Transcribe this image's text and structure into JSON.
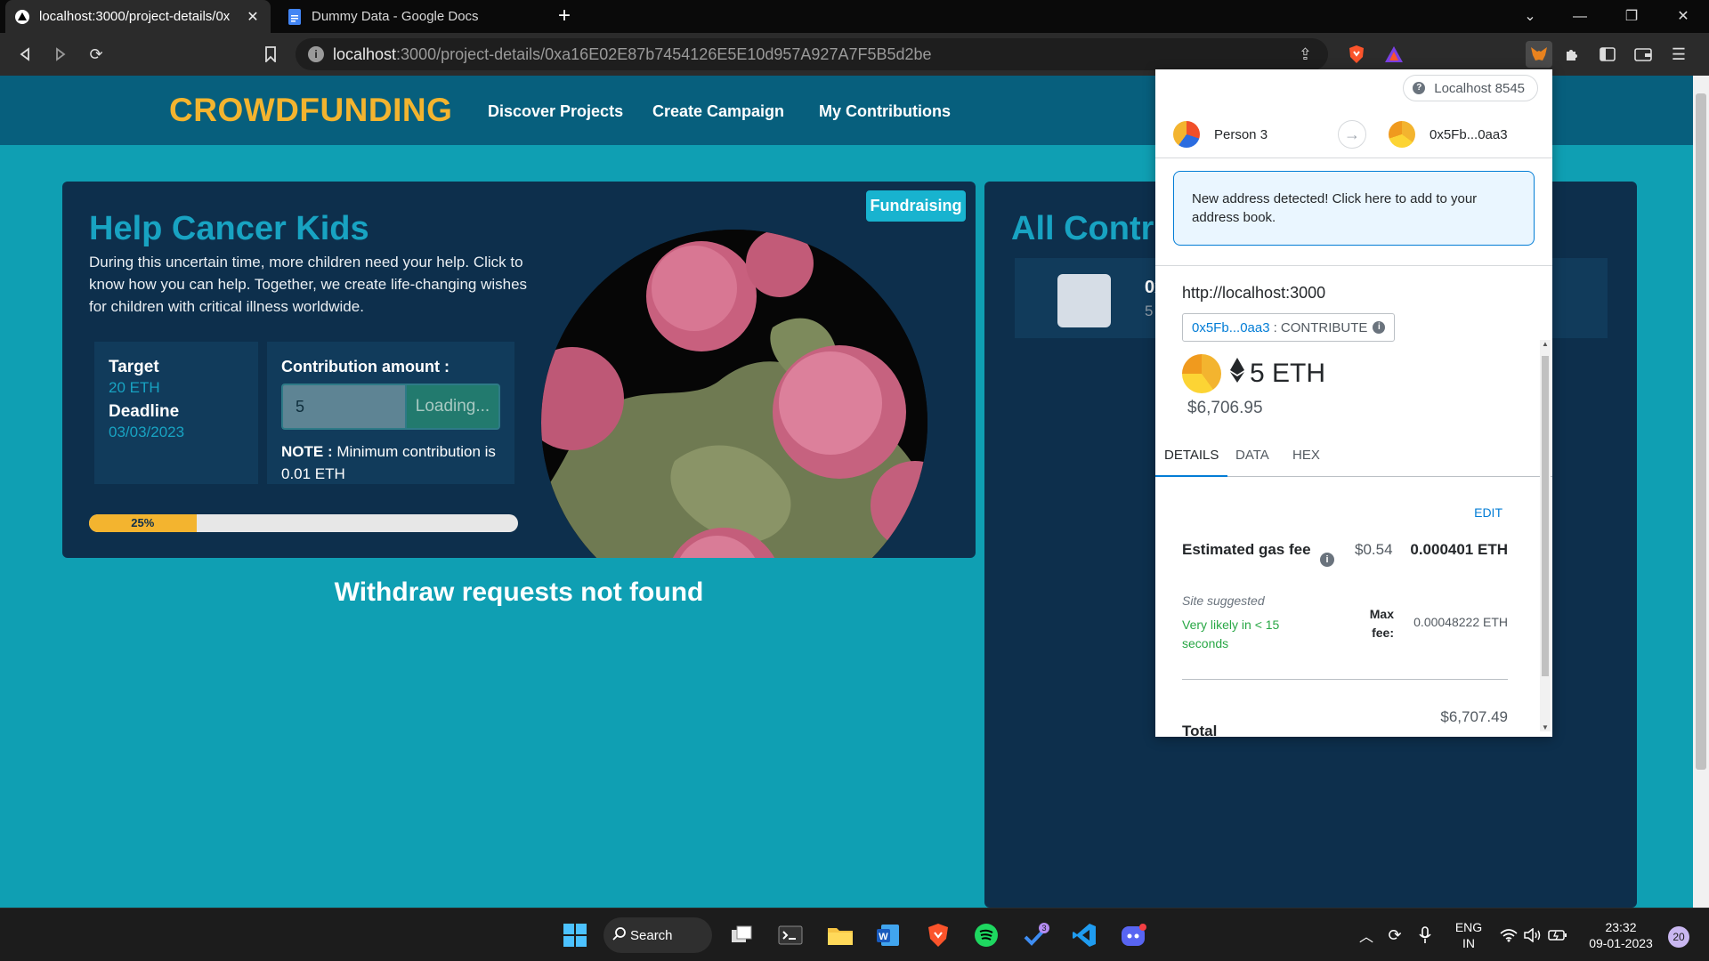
{
  "browser": {
    "tabs": [
      {
        "title": "localhost:3000/project-details/0x"
      },
      {
        "title": "Dummy Data - Google Docs"
      }
    ],
    "url_host": "localhost",
    "url_rest": ":3000/project-details/0xa16E02E87b7454126E5E10d957A927A7F5B5d2be"
  },
  "navbar": {
    "brand": "CROWDFUNDING",
    "links": [
      "Discover Projects",
      "Create Campaign",
      "My Contributions"
    ]
  },
  "project": {
    "status": "Fundraising",
    "title": "Help Cancer Kids",
    "description": "During this uncertain time, more children need your help. Click to know how you can help. Together, we create life-changing wishes for children with critical illness worldwide.",
    "target_label": "Target",
    "target_value": "20 ETH",
    "deadline_label": "Deadline",
    "deadline_value": "03/03/2023",
    "contribution_label": "Contribution amount :",
    "contribution_value": "5",
    "contribute_button": "Loading...",
    "note_label": "NOTE :",
    "note_text": "Minimum contribution is 0.01 ETH",
    "progress": 0.25,
    "progress_label": "25%"
  },
  "withdraw_message": "Withdraw requests not found",
  "contributions": {
    "title": "All Contri",
    "items": [
      {
        "address": "0x",
        "amount": "5"
      }
    ]
  },
  "metamask": {
    "network": "Localhost 8545",
    "from_account": "Person 3",
    "to_account": "0x5Fb...0aa3",
    "alert": "New address detected! Click here to add to your address book.",
    "origin": "http://localhost:3000",
    "method_address": "0x5Fb...0aa3",
    "method_name": ": CONTRIBUTE",
    "amount": "5 ETH",
    "amount_fiat": "$6,706.95",
    "tabs": [
      "DETAILS",
      "DATA",
      "HEX"
    ],
    "edit": "EDIT",
    "gas_label": "Estimated gas fee",
    "gas_fiat": "$0.54",
    "gas_eth": "0.000401 ETH",
    "site_suggested": "Site suggested",
    "likely": "Very likely in < 15 seconds",
    "max_fee_label": "Max fee:",
    "max_fee_value": "0.00048222 ETH",
    "total_fiat": "$6,707.49",
    "total_label": "Total",
    "colors": {
      "link": "#037dd6",
      "success": "#28a745"
    }
  },
  "taskbar": {
    "search": "Search",
    "language": "ENG",
    "region": "IN",
    "time": "23:32",
    "date": "09-01-2023",
    "notifications": "20",
    "todo_badge": "3"
  },
  "icons": [
    "back-icon",
    "forward-icon",
    "reload-icon",
    "bookmark-icon",
    "share-icon",
    "brave-shields-icon",
    "brave-rewards-icon",
    "metamask-icon",
    "extensions-icon",
    "sidebar-icon",
    "wallet-icon",
    "menu-icon"
  ],
  "colors": {
    "brand": "#f3b42f",
    "accent": "#18a3c2",
    "page": "#0f9fb3",
    "card": "#0d2f4c"
  }
}
